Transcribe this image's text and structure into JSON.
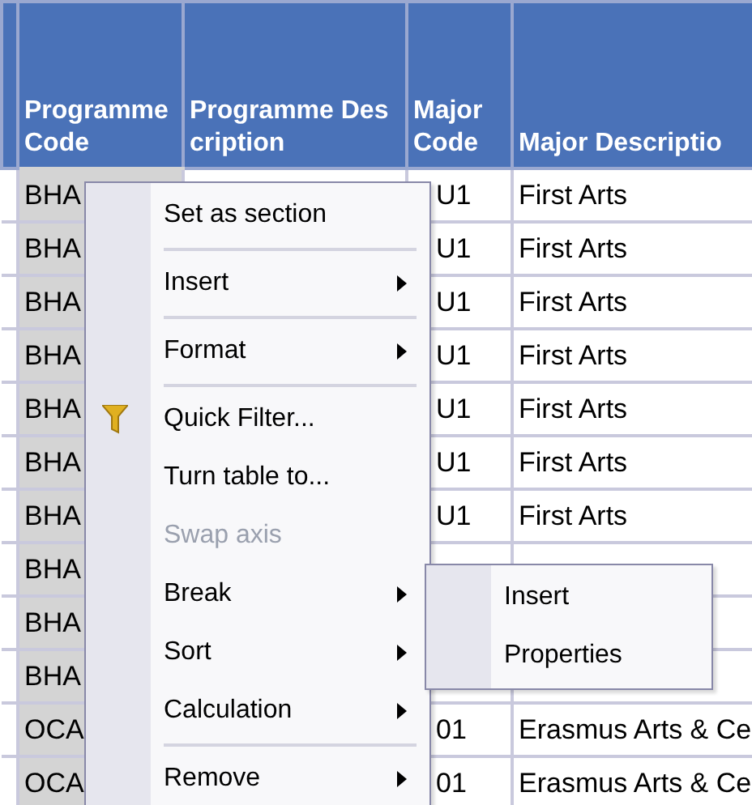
{
  "table": {
    "columns": [
      {
        "label": "Programme Code",
        "selected": true
      },
      {
        "label": "Programme Description",
        "selected": false
      },
      {
        "label": "Major Code",
        "selected": false
      },
      {
        "label": "Major Descriptio",
        "selected": false
      }
    ],
    "rows": [
      {
        "code": "BHA",
        "major_code": "U1",
        "major_description": "First Arts"
      },
      {
        "code": "BHA",
        "major_code": "U1",
        "major_description": "First Arts"
      },
      {
        "code": "BHA",
        "major_code": "U1",
        "major_description": "First Arts"
      },
      {
        "code": "BHA",
        "major_code": "U1",
        "major_description": "First Arts"
      },
      {
        "code": "BHA",
        "major_code": "U1",
        "major_description": "First Arts"
      },
      {
        "code": "BHA",
        "major_code": "U1",
        "major_description": "First Arts"
      },
      {
        "code": "BHA",
        "major_code": "U1",
        "major_description": "First Arts"
      },
      {
        "code": "BHA"
      },
      {
        "code": "BHA"
      },
      {
        "code": "BHA"
      },
      {
        "code": "OCA",
        "major_code": "01",
        "major_description": "Erasmus Arts & Ce"
      },
      {
        "code": "OCA",
        "major_code": "01",
        "major_description": "Erasmus Arts & Ce"
      }
    ]
  },
  "context_menu": {
    "items": [
      {
        "kind": "item",
        "label": "Set as section",
        "submenu": false,
        "disabled": false,
        "icon": false
      },
      {
        "kind": "separator"
      },
      {
        "kind": "item",
        "label": "Insert",
        "submenu": true,
        "disabled": false,
        "icon": false
      },
      {
        "kind": "separator"
      },
      {
        "kind": "item",
        "label": "Format",
        "submenu": true,
        "disabled": false,
        "icon": false
      },
      {
        "kind": "separator"
      },
      {
        "kind": "item",
        "label": "Quick Filter...",
        "submenu": false,
        "disabled": false,
        "icon": true
      },
      {
        "kind": "item",
        "label": "Turn table to...",
        "submenu": false,
        "disabled": false,
        "icon": false
      },
      {
        "kind": "item",
        "label": "Swap axis",
        "submenu": false,
        "disabled": true,
        "icon": false
      },
      {
        "kind": "item",
        "label": "Break",
        "submenu": true,
        "disabled": false,
        "icon": false
      },
      {
        "kind": "item",
        "label": "Sort",
        "submenu": true,
        "disabled": false,
        "icon": false
      },
      {
        "kind": "item",
        "label": "Calculation",
        "submenu": true,
        "disabled": false,
        "icon": false
      },
      {
        "kind": "separator"
      },
      {
        "kind": "item",
        "label": "Remove",
        "submenu": true,
        "disabled": false,
        "icon": false
      }
    ]
  },
  "submenu": {
    "items": [
      {
        "label": "Insert"
      },
      {
        "label": "Properties"
      }
    ]
  }
}
